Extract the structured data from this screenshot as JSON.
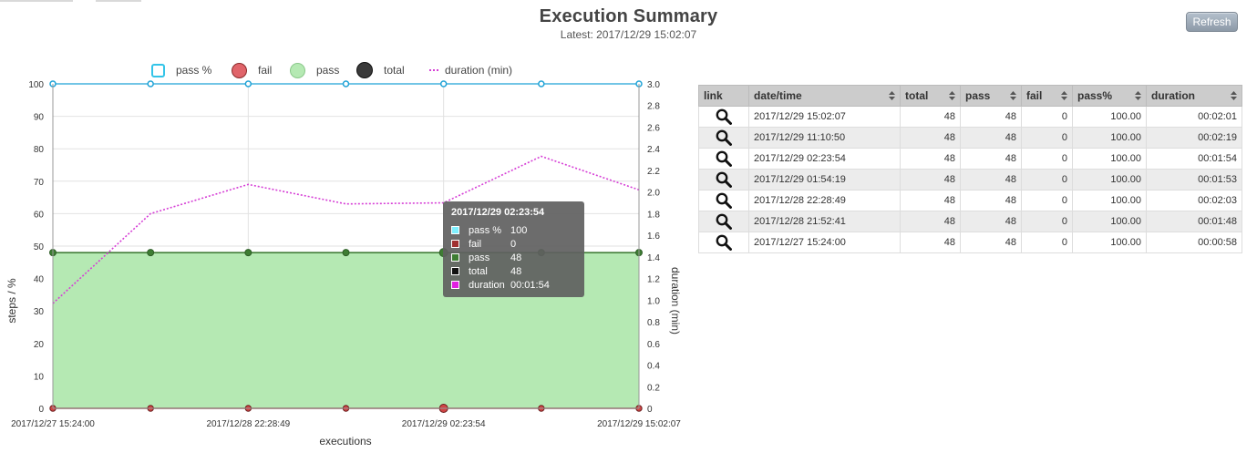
{
  "header": {
    "title": "Execution Summary",
    "subtitle": "Latest: 2017/12/29 15:02:07",
    "refresh_label": "Refresh"
  },
  "chart_data": {
    "type": "line",
    "xlabel": "executions",
    "ylabel": "steps / %",
    "y2label": "duration (min)",
    "ylim": [
      0,
      100
    ],
    "y2lim": [
      0,
      3.0
    ],
    "yticks": [
      "0",
      "10",
      "20",
      "30",
      "40",
      "50",
      "60",
      "70",
      "80",
      "90",
      "100"
    ],
    "y2ticks": [
      "0",
      "0.2",
      "0.4",
      "0.6",
      "0.8",
      "1.0",
      "1.2",
      "1.4",
      "1.6",
      "1.8",
      "2.0",
      "2.2",
      "2.4",
      "2.6",
      "2.8",
      "3.0"
    ],
    "x_tick_labels": [
      {
        "index": 0,
        "label": "2017/12/27 15:24:00"
      },
      {
        "index": 2,
        "label": "2017/12/28 22:28:49"
      },
      {
        "index": 4,
        "label": "2017/12/29 02:23:54"
      },
      {
        "index": 6,
        "label": "2017/12/29 15:02:07"
      }
    ],
    "x_count": 7,
    "series": [
      {
        "name": "pass %",
        "axis": "left",
        "values": [
          100,
          100,
          100,
          100,
          100,
          100,
          100
        ],
        "color": "#1fa2d6"
      },
      {
        "name": "fail",
        "axis": "left",
        "values": [
          0,
          0,
          0,
          0,
          0,
          0,
          0
        ],
        "color": "#b03a3a"
      },
      {
        "name": "pass",
        "axis": "left",
        "values": [
          48,
          48,
          48,
          48,
          48,
          48,
          48
        ],
        "color": "#3e7d33",
        "fill": "#b5e9b3"
      },
      {
        "name": "total",
        "axis": "left",
        "values": [
          48,
          48,
          48,
          48,
          48,
          48,
          48
        ],
        "color": "#222222"
      },
      {
        "name": "duration (min)",
        "axis": "right",
        "values": [
          0.97,
          1.8,
          2.07,
          1.89,
          1.9,
          2.33,
          2.02
        ],
        "color": "#d63fd6"
      }
    ],
    "grid": true,
    "legend_position": "top"
  },
  "tooltip": {
    "title": "2017/12/29 02:23:54",
    "rows": [
      {
        "label": "pass %",
        "value": "100",
        "color": "#7ff0ff"
      },
      {
        "label": "fail",
        "value": "0",
        "color": "#a03030"
      },
      {
        "label": "pass",
        "value": "48",
        "color": "#3e7d33"
      },
      {
        "label": "total",
        "value": "48",
        "color": "#111111"
      },
      {
        "label": "duration",
        "value": "00:01:54",
        "color": "#e020e0"
      }
    ]
  },
  "table": {
    "headers": [
      "link",
      "date/time",
      "total",
      "pass",
      "fail",
      "pass%",
      "duration"
    ],
    "rows": [
      {
        "datetime": "2017/12/29 15:02:07",
        "total": "48",
        "pass": "48",
        "fail": "0",
        "pass_pct": "100.00",
        "duration": "00:02:01"
      },
      {
        "datetime": "2017/12/29 11:10:50",
        "total": "48",
        "pass": "48",
        "fail": "0",
        "pass_pct": "100.00",
        "duration": "00:02:19"
      },
      {
        "datetime": "2017/12/29 02:23:54",
        "total": "48",
        "pass": "48",
        "fail": "0",
        "pass_pct": "100.00",
        "duration": "00:01:54"
      },
      {
        "datetime": "2017/12/29 01:54:19",
        "total": "48",
        "pass": "48",
        "fail": "0",
        "pass_pct": "100.00",
        "duration": "00:01:53"
      },
      {
        "datetime": "2017/12/28 22:28:49",
        "total": "48",
        "pass": "48",
        "fail": "0",
        "pass_pct": "100.00",
        "duration": "00:02:03"
      },
      {
        "datetime": "2017/12/28 21:52:41",
        "total": "48",
        "pass": "48",
        "fail": "0",
        "pass_pct": "100.00",
        "duration": "00:01:48"
      },
      {
        "datetime": "2017/12/27 15:24:00",
        "total": "48",
        "pass": "48",
        "fail": "0",
        "pass_pct": "100.00",
        "duration": "00:00:58"
      }
    ],
    "link_icon": "magnifier-icon"
  }
}
